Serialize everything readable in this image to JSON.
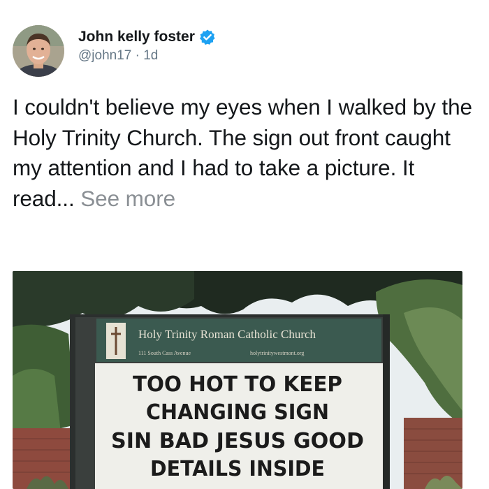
{
  "user": {
    "display_name": "John kelly foster",
    "handle": "@john17",
    "separator": " · ",
    "time": "1d",
    "verified_icon": "verified-badge-icon",
    "badge_color": "#1da1f2"
  },
  "tweet": {
    "text": "I couldn't believe my eyes when I walked by the Holy Trinity Church. The sign out front caught my attention and I had to take a picture. It read... ",
    "see_more": "See more"
  },
  "photo": {
    "church_name": "Holy Trinity Roman Catholic Church",
    "address": "111 South Cass Avenue",
    "website": "holytrinitywestmont.org",
    "sign_lines": [
      "TOO HOT TO KEEP",
      "CHANGING SIGN",
      "SIN BAD JESUS GOOD",
      "DETAILS INSIDE"
    ]
  }
}
